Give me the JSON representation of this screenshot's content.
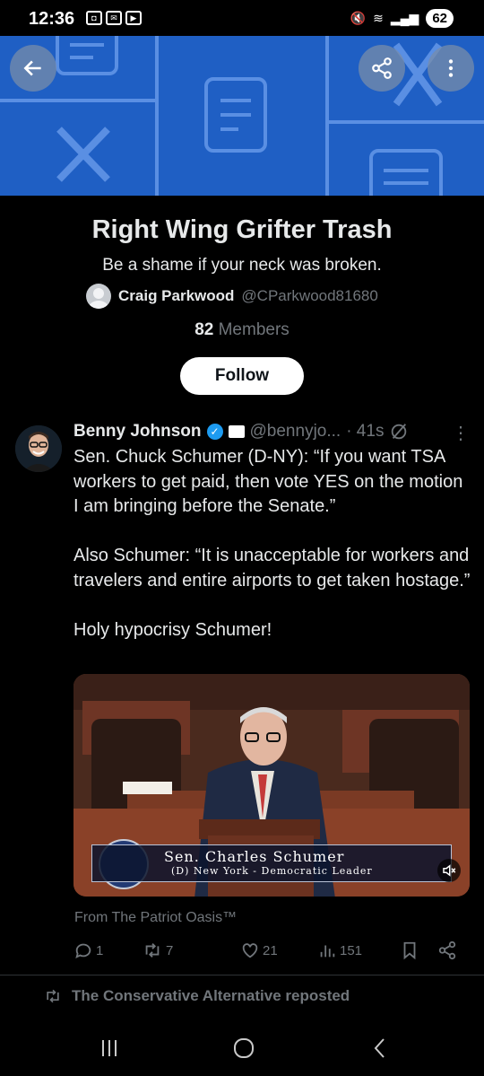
{
  "status_bar": {
    "time": "12:36",
    "battery": "62"
  },
  "community": {
    "title": "Right Wing Grifter Trash",
    "description": "Be a shame if your neck was broken.",
    "creator_name": "Craig Parkwood",
    "creator_handle": "@CParkwood81680",
    "member_count": "82",
    "member_label": "Members",
    "follow_label": "Follow"
  },
  "tweet": {
    "author_name": "Benny Johnson",
    "author_handle": "@bennyjo...",
    "time": "· 41s",
    "paragraphs": [
      "Sen. Chuck Schumer (D-NY): “If you want TSA workers to get paid, then vote YES on the motion I am bringing before the Senate.”",
      "Also Schumer: “It is unacceptable for workers and travelers and entire airports to get taken hostage.”",
      "Holy hypocrisy Schumer!"
    ],
    "video": {
      "lower_third_name": "Sen. Charles Schumer",
      "lower_third_sub": "(D) New York - Democratic Leader"
    },
    "source": "From The Patriot Oasis™",
    "replies": "1",
    "reposts": "7",
    "likes": "21",
    "views": "151"
  },
  "next_item": {
    "repost_text": "The Conservative Alternative reposted"
  },
  "colors": {
    "banner": "#1f5fc4",
    "verified": "#1d9bf0",
    "muted": "#71767b"
  }
}
